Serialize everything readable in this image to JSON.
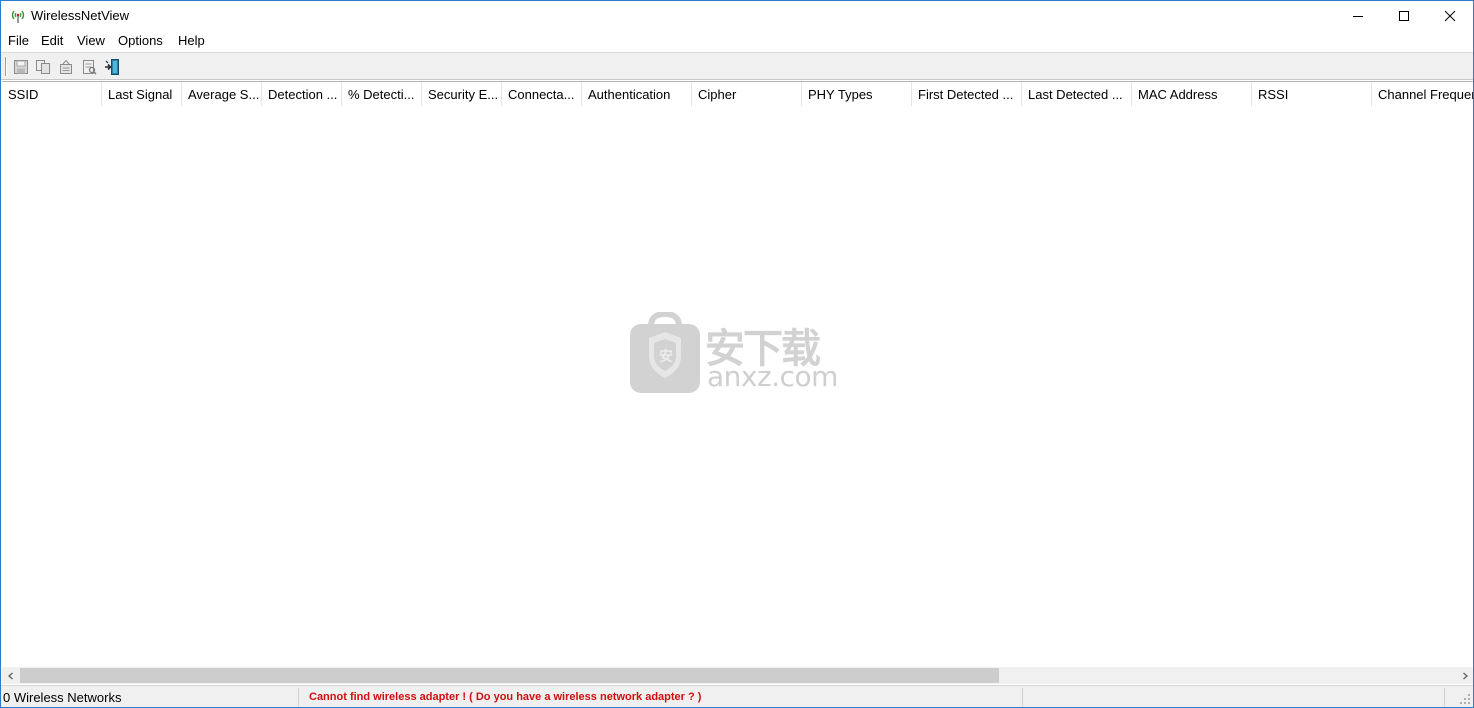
{
  "window": {
    "title": "WirelessNetView"
  },
  "menu": [
    "File",
    "Edit",
    "View",
    "Options",
    "Help"
  ],
  "toolbar": {
    "buttons": [
      "save-icon",
      "copy-icon",
      "html-report-icon",
      "properties-icon",
      "exit-icon"
    ]
  },
  "columns": [
    "SSID",
    "Last Signal",
    "Average S...",
    "Detection ...",
    "% Detecti...",
    "Security E...",
    "Connecta...",
    "Authentication",
    "Cipher",
    "PHY Types",
    "First Detected ...",
    "Last Detected ...",
    "MAC Address",
    "RSSI",
    "Channel Frequency"
  ],
  "watermark": {
    "cn": "安下载",
    "domain": "anxz.com"
  },
  "status": {
    "count": "0 Wireless Networks",
    "message": "Cannot find wireless adapter !    ( Do you have a wireless network adapter ? )",
    "message_color": "#d01010",
    "extra": ""
  }
}
